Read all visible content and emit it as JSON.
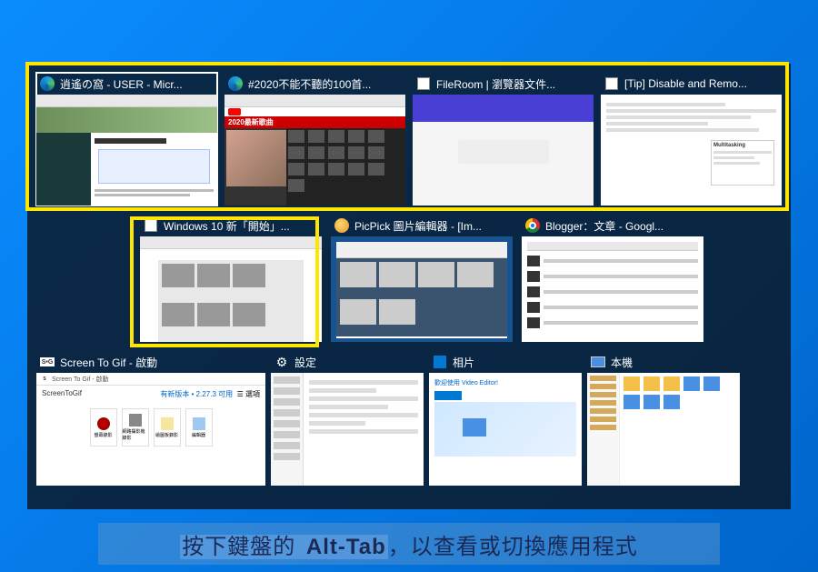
{
  "caption": {
    "prefix": "按下鍵盤的 ",
    "key": "Alt-Tab",
    "suffix": "，以查看或切換應用程式"
  },
  "tiles": {
    "r1": [
      {
        "title": "逍遙の窩 - USER - Micr...",
        "icon": "edge"
      },
      {
        "title": "#2020不能不聽的100首...",
        "icon": "edge"
      },
      {
        "title": "FileRoom | 瀏覽器文件...",
        "icon": "edge-tab"
      },
      {
        "title": "[Tip] Disable and Remo...",
        "icon": "edge-tab"
      }
    ],
    "r2": [
      {
        "title": "Windows 10 新「開始」...",
        "icon": "edge-tab"
      },
      {
        "title": "PicPick 圖片編輯器 - [Im...",
        "icon": "picpick"
      },
      {
        "title": "Blogger：文章 - Googl...",
        "icon": "chrome"
      }
    ],
    "r3": [
      {
        "title": "Screen To Gif - 啟動",
        "icon": "stg"
      },
      {
        "title": "設定",
        "icon": "gear"
      },
      {
        "title": "相片",
        "icon": "photos"
      },
      {
        "title": "本機",
        "icon": "pc"
      }
    ]
  },
  "stg": {
    "topbar": "Screen To Gif - 啟動",
    "appname": "ScreenToGif",
    "version": "有新版本 • 2.27.3 可用",
    "options": "選項",
    "b1": "螢幕錄影",
    "b2": "網路攝影機錄影",
    "b3": "繪圖板錄影",
    "b4": "編輯器"
  },
  "yt": {
    "banner": "2020最新歌曲"
  },
  "photos": {
    "header": "歡迎使用 Video Editor!"
  },
  "tip": {
    "heading": "Multitasking"
  }
}
